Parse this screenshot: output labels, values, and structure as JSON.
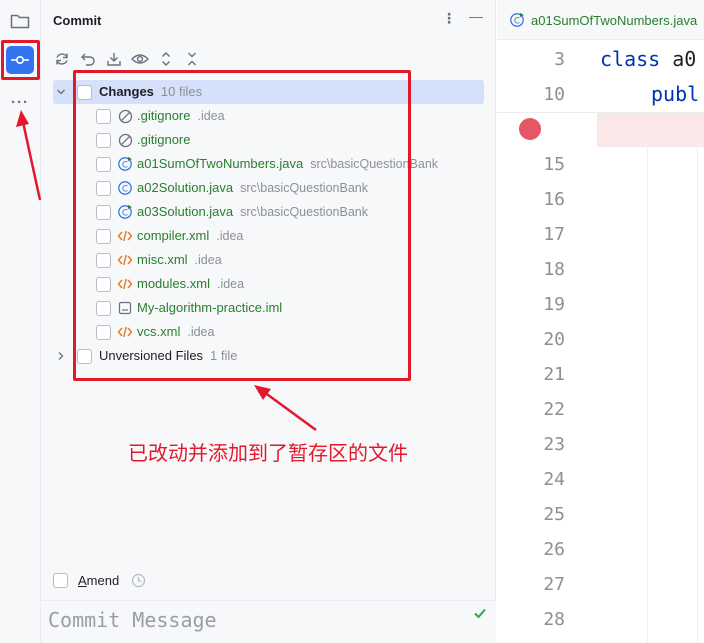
{
  "panel": {
    "title": "Commit",
    "menu_glyph": "⋮",
    "minimize_glyph": "—"
  },
  "strip": {
    "more_glyph": "···"
  },
  "toolbar": {
    "icons": [
      "refresh-icon",
      "rollback-icon",
      "download-icon",
      "eye-icon",
      "expand-icon",
      "collapse-icon"
    ]
  },
  "changes": {
    "name": "Changes",
    "count": "10 files",
    "files": [
      {
        "name": ".gitignore",
        "path": ".idea",
        "icon": "ignored-icon",
        "color": "green"
      },
      {
        "name": ".gitignore",
        "path": "",
        "icon": "ignored-icon",
        "color": "green"
      },
      {
        "name": "a01SumOfTwoNumbers.java",
        "path": "src\\basicQuestionBank",
        "icon": "java-class-main-icon",
        "color": "green"
      },
      {
        "name": "a02Solution.java",
        "path": "src\\basicQuestionBank",
        "icon": "java-class-icon",
        "color": "green"
      },
      {
        "name": "a03Solution.java",
        "path": "src\\basicQuestionBank",
        "icon": "java-class-main-icon",
        "color": "green"
      },
      {
        "name": "compiler.xml",
        "path": ".idea",
        "icon": "xml-icon",
        "color": "green"
      },
      {
        "name": "misc.xml",
        "path": ".idea",
        "icon": "xml-icon",
        "color": "green"
      },
      {
        "name": "modules.xml",
        "path": ".idea",
        "icon": "xml-icon",
        "color": "green"
      },
      {
        "name": "My-algorithm-practice.iml",
        "path": "",
        "icon": "module-file-icon",
        "color": "green"
      },
      {
        "name": "vcs.xml",
        "path": ".idea",
        "icon": "xml-icon",
        "color": "green"
      }
    ]
  },
  "unversioned": {
    "name": "Unversioned Files",
    "count": "1 file"
  },
  "annotation": "已改动并添加到了暂存区的文件",
  "amend": {
    "label_underlined": "A",
    "label_rest": "mend"
  },
  "commit_message": {
    "placeholder": "Commit Message"
  },
  "editor": {
    "tab_label": "a01SumOfTwoNumbers.java",
    "line_numbers": [
      "3",
      "10",
      "15",
      "16",
      "17",
      "18",
      "19",
      "20",
      "21",
      "22",
      "23",
      "24",
      "25",
      "26",
      "27",
      "28"
    ],
    "code": [
      {
        "keyword": "class",
        "rest": " a0"
      },
      {
        "keyword": "publ",
        "rest": ""
      }
    ]
  },
  "colors": {
    "accent": "#3574f0",
    "annotation_red": "#e3192b",
    "vcs_added_green": "#2a7d2e",
    "breakpoint": "#e55765",
    "keyword": "#0033b3"
  }
}
